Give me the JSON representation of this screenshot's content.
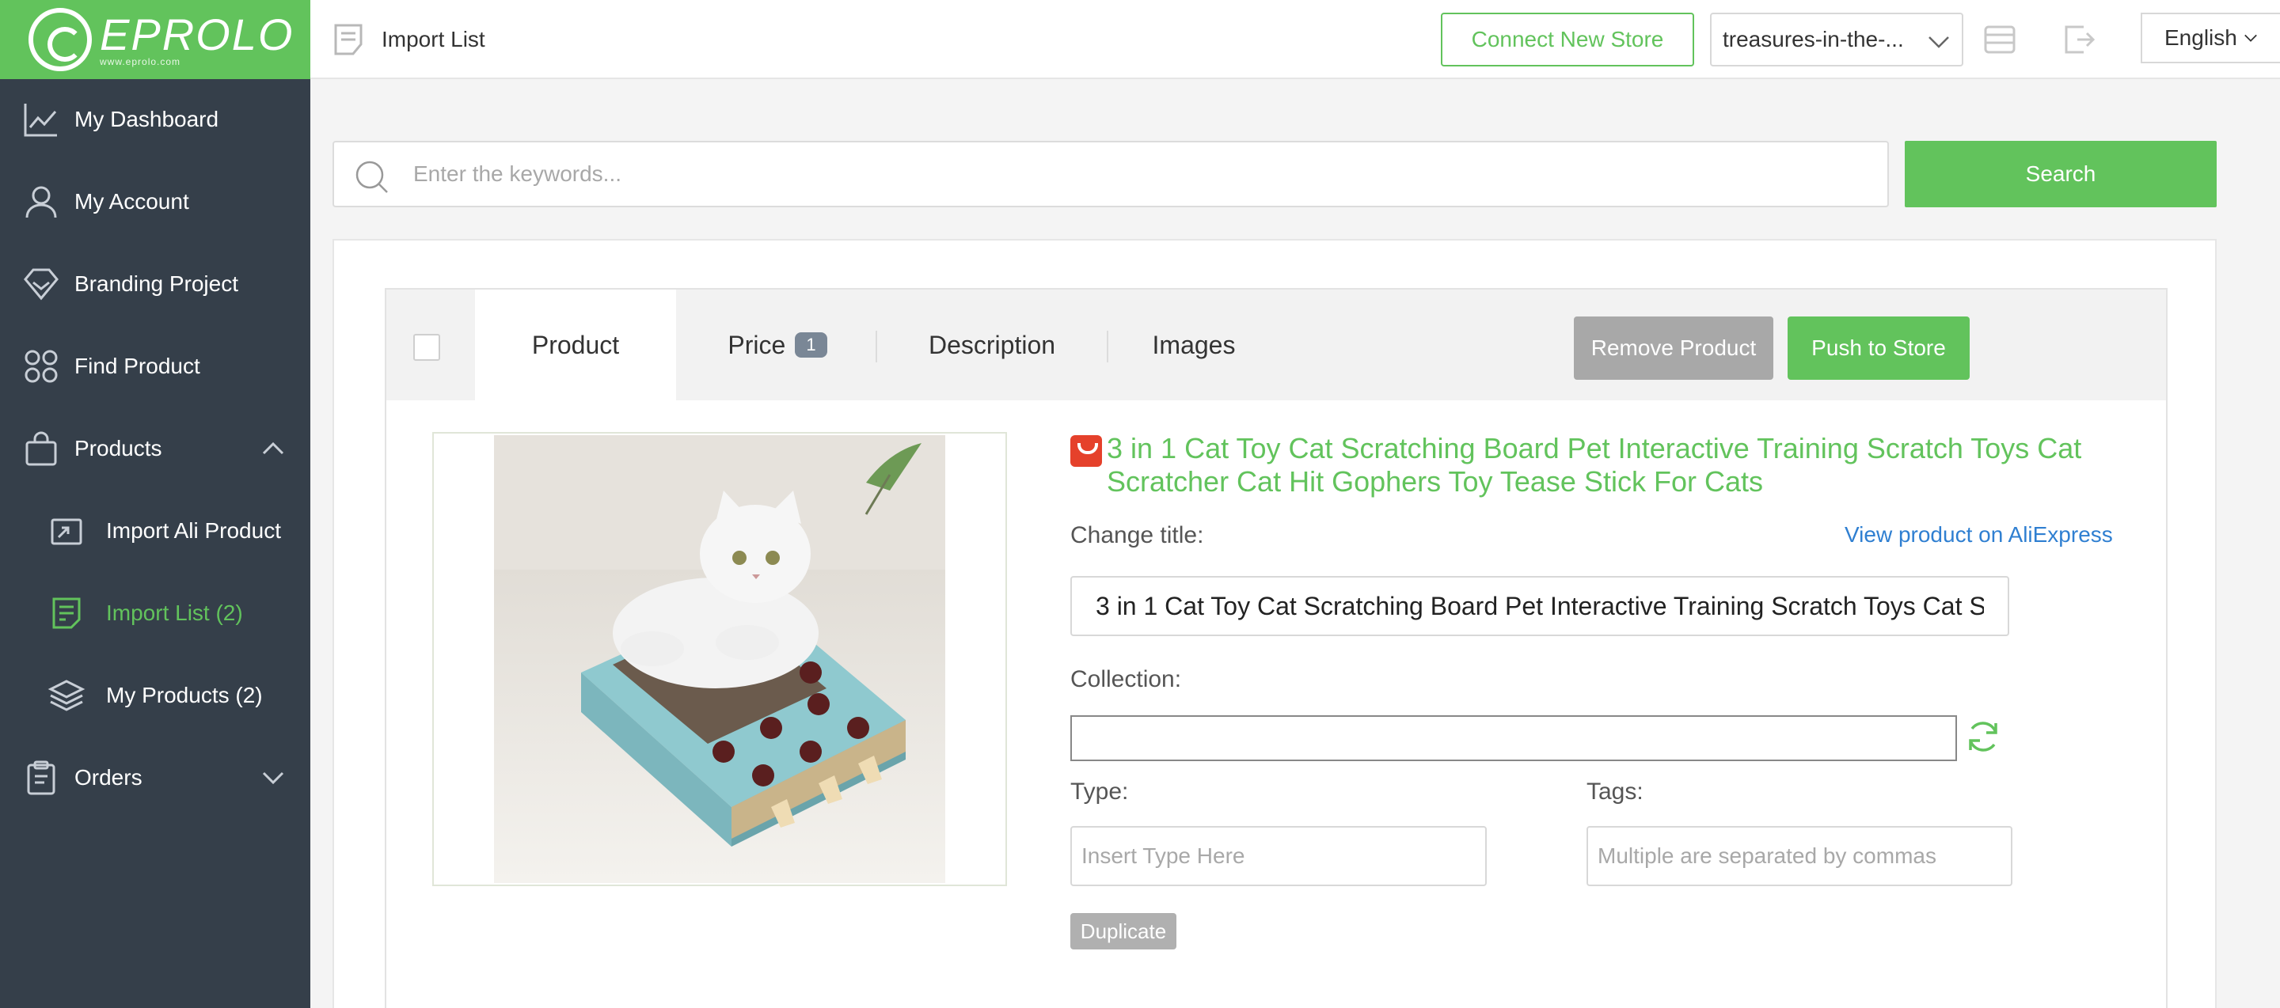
{
  "brand": {
    "name": "EPROLO",
    "domain": "www.eprolo.com"
  },
  "sidebar": {
    "items": [
      {
        "label": "My Dashboard",
        "icon": "dashboard-chart-icon"
      },
      {
        "label": "My Account",
        "icon": "user-icon"
      },
      {
        "label": "Branding Project",
        "icon": "diamond-icon"
      },
      {
        "label": "Find Product",
        "icon": "grid-icon"
      },
      {
        "label": "Products",
        "icon": "bag-icon",
        "expanded": true
      },
      {
        "label": "Import Ali Product",
        "icon": "import-icon"
      },
      {
        "label": "Import List (2)",
        "icon": "list-icon",
        "active": true
      },
      {
        "label": "My Products (2)",
        "icon": "layers-icon"
      },
      {
        "label": "Orders",
        "icon": "clipboard-icon",
        "expanded": false
      }
    ]
  },
  "header": {
    "page_title": "Import List",
    "connect_store_label": "Connect New Store",
    "store_selected": "treasures-in-the-...",
    "language": "English"
  },
  "search": {
    "placeholder": "Enter the keywords...",
    "button_label": "Search"
  },
  "tabs": {
    "product": "Product",
    "price": "Price",
    "price_badge": "1",
    "description": "Description",
    "images": "Images"
  },
  "actions": {
    "remove": "Remove Product",
    "push": "Push to Store"
  },
  "product": {
    "title": "3 in 1 Cat Toy Cat Scratching Board Pet Interactive Training Scratch Toys Cat Scratcher Cat Hit Gophers Toy Tease Stick For Cats",
    "change_title_label": "Change title:",
    "view_link": "View product on AliExpress",
    "title_value": "3 in 1 Cat Toy Cat Scratching Board Pet Interactive Training Scratch Toys Cat Scratcher Cat Hit Gophers Toy Tease Stick For Cats",
    "collection_label": "Collection:",
    "collection_value": "",
    "type_label": "Type:",
    "type_placeholder": "Insert Type Here",
    "tags_label": "Tags:",
    "tags_placeholder": "Multiple are separated by commas",
    "duplicate_label": "Duplicate"
  },
  "colors": {
    "accent": "#62c35c",
    "sidebar": "#353f4a",
    "link": "#2f7fd1",
    "aliexpress": "#e5412b"
  }
}
